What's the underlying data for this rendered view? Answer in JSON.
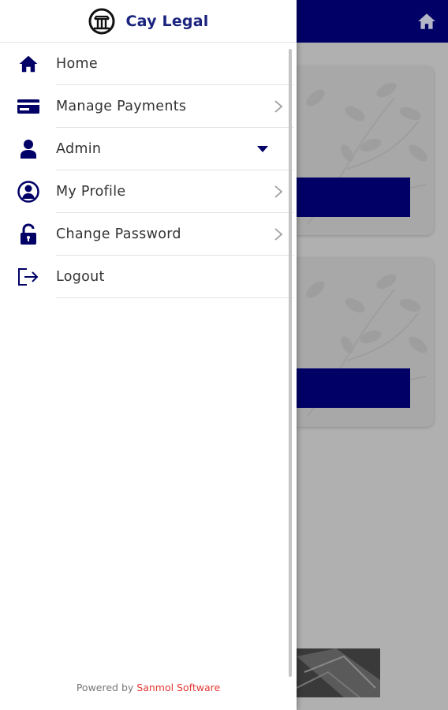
{
  "app": {
    "brand": "Cay Legal"
  },
  "menu": {
    "items": [
      {
        "label": "Home",
        "icon": "home-icon"
      },
      {
        "label": "Manage Payments",
        "icon": "credit-card-icon"
      },
      {
        "label": "Admin",
        "icon": "user-icon"
      },
      {
        "label": "My Profile",
        "icon": "profile-icon"
      },
      {
        "label": "Change Password",
        "icon": "lock-open-icon"
      },
      {
        "label": "Logout",
        "icon": "logout-icon"
      }
    ]
  },
  "footer": {
    "prefix": "Powered by",
    "company": "Sanmol Software"
  },
  "colors": {
    "primary": "#000066",
    "brand_text": "#1a237e",
    "accent_red": "#e53935",
    "overlay": "#b0b0b0"
  }
}
